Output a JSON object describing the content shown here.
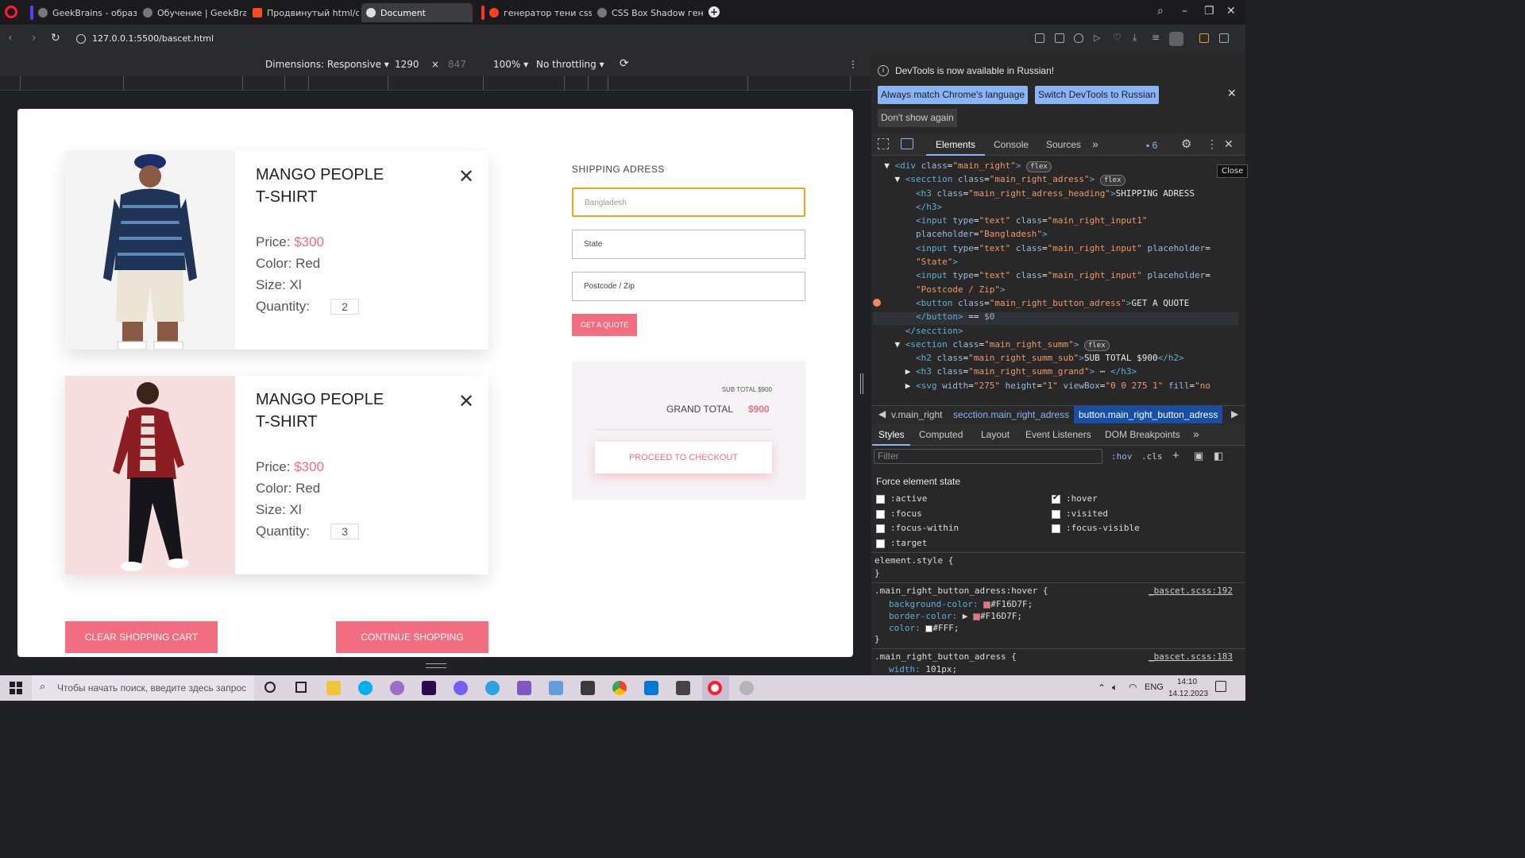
{
  "tabs": [
    {
      "label": "GeekBrains - образовате",
      "active": false
    },
    {
      "label": "Обучение | GeekBrains - ·",
      "active": false
    },
    {
      "label": "Продвинутый html/css (С",
      "active": false
    },
    {
      "label": "Document",
      "active": true
    },
    {
      "label": "генератор тени css — Ян",
      "active": false
    },
    {
      "label": "CSS Box Shadow генерато",
      "active": false
    }
  ],
  "address": {
    "url": "127.0.0.1:5500/bascet.html"
  },
  "device_toolbar": {
    "dimensions": "Dimensions: Responsive ▾",
    "width": "1290",
    "x": "×",
    "height": "847",
    "zoom": "100% ▾",
    "throttle": "No throttling ▾"
  },
  "cart": {
    "items": [
      {
        "title": "MANGO PEOPLE T-SHIRT",
        "price_label": "Price: ",
        "price": "$300",
        "color": "Color: Red",
        "size": "Size: Xl",
        "qty_label": "Quantity:",
        "qty": "2"
      },
      {
        "title": "MANGO PEOPLE T-SHIRT",
        "price_label": "Price: ",
        "price": "$300",
        "color": "Color: Red",
        "size": "Size: Xl",
        "qty_label": "Quantity:",
        "qty": "3"
      }
    ],
    "clear_btn": "CLEAR SHOPPING CART",
    "continue_btn": "CONTINUE SHOPPING"
  },
  "shipping": {
    "heading": "SHIPPING ADRESS",
    "country_placeholder": "Bangladesh",
    "state_placeholder": "State",
    "zip_placeholder": "Postcode / Zip",
    "quote_btn": "GET A QUOTE"
  },
  "summary": {
    "sub": "SUB TOTAL $900",
    "grand_label": "GRAND TOTAL",
    "grand_value": "$900",
    "checkout": "PROCEED TO CHECKOUT"
  },
  "devtools": {
    "notice": "DevTools is now available in Russian!",
    "btn_match": "Always match Chrome's language",
    "btn_switch": "Switch DevTools to Russian",
    "btn_dont": "Don't show again",
    "tabs": [
      "Elements",
      "Console",
      "Sources"
    ],
    "issues": "6",
    "tooltip": "Close",
    "breadcrumbs": [
      "v.main_right",
      "secction.main_right_adress",
      "button.main_right_button_adress"
    ],
    "style_tabs": [
      "Styles",
      "Computed",
      "Layout",
      "Event Listeners",
      "DOM Breakpoints"
    ],
    "filter_placeholder": "Filter",
    "hov": ":hov",
    "cls": ".cls",
    "force_state": "Force element state",
    "states": [
      ":active",
      ":focus",
      ":focus-within",
      ":target",
      ":hover",
      ":visited",
      ":focus-visible"
    ],
    "element_style": "element.style {",
    "rule1_selector": ".main_right_button_adress:hover {",
    "rule1_source": "_bascet.scss:192",
    "rule1_props": [
      "background-color:",
      "border-color:",
      "color:"
    ],
    "rule1_values": [
      "#F16D7F;",
      "#F16D7F;",
      "#FFF;"
    ],
    "rule2_selector": ".main_right_button_adress {",
    "rule2_source": "_bascet.scss:183",
    "rule2_prop": "width:",
    "rule2_value": "101px;",
    "colors": {
      "pink": "#F16D7F",
      "white": "#FFF"
    }
  },
  "taskbar": {
    "search": "Чтобы начать поиск, введите здесь запрос",
    "lang": "ENG",
    "time": "14:10",
    "date": "14.12.2023"
  }
}
